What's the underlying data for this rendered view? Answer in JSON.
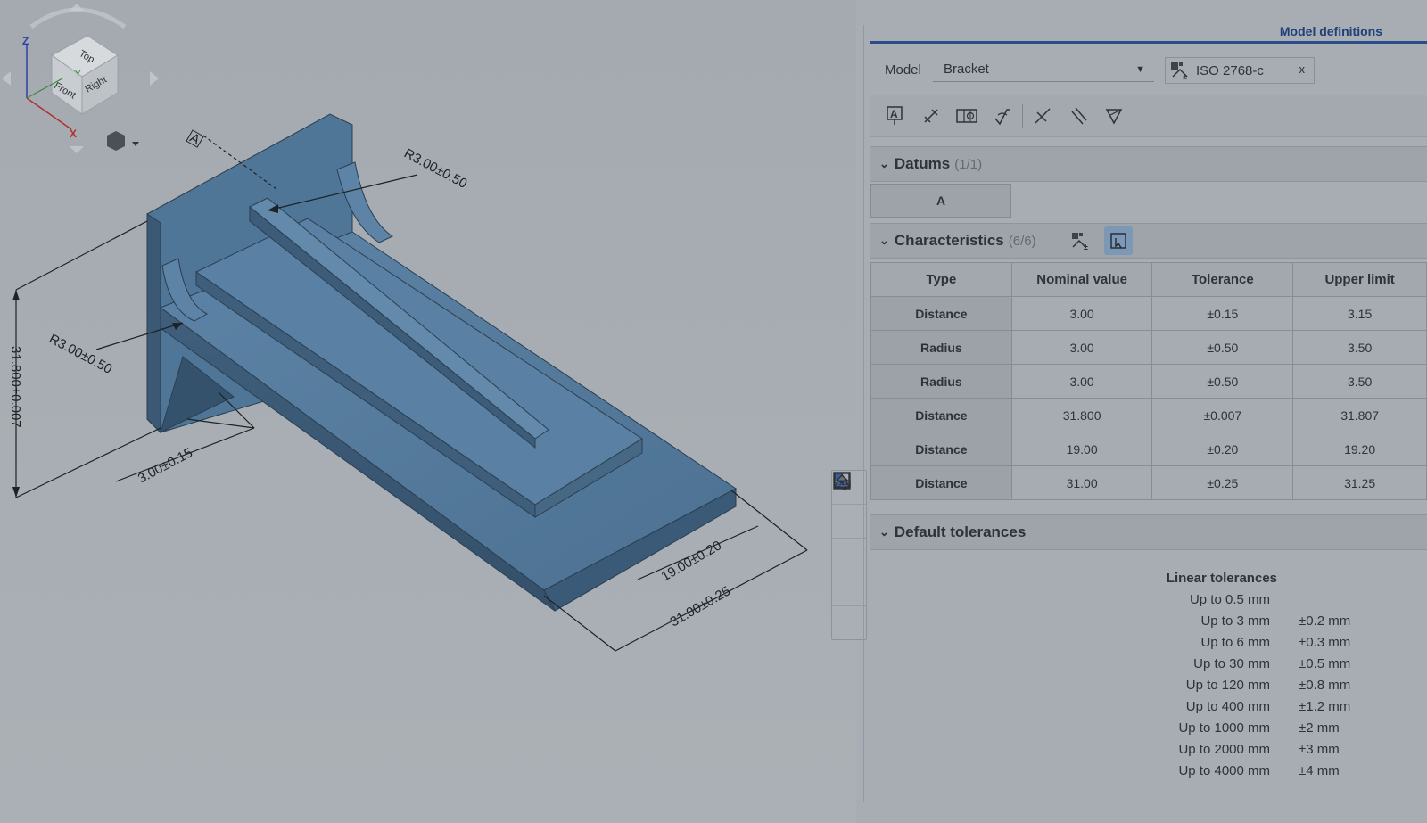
{
  "viewport": {
    "dimensions": [
      {
        "id": "r-top",
        "text": "R3.00±0.50"
      },
      {
        "id": "r-left",
        "text": "R3.00±0.50"
      },
      {
        "id": "vertical",
        "text": "31.800±0.007"
      },
      {
        "id": "depth",
        "text": "3.00±0.15"
      },
      {
        "id": "nineteen",
        "text": "19.00±0.20"
      },
      {
        "id": "thirtyone",
        "text": "31.00±0.25"
      }
    ],
    "datum_flag": "A",
    "viewcube": {
      "top": "Top",
      "front": "Front",
      "right": "Right",
      "axis_z": "Z",
      "axis_x": "X",
      "axis_y": "Y"
    },
    "side_tools": [
      "section-view-icon",
      "explode-view-icon",
      "named-views-icon",
      "render-mode-icon",
      "variables-icon"
    ]
  },
  "panel": {
    "title": "Model definitions",
    "model_label": "Model",
    "model_value": "Bracket",
    "standard": "ISO 2768-c",
    "standard_remove": "x",
    "toolbar_icons": [
      "annotation-icon",
      "dimension-icon",
      "feature-control-frame-icon",
      "surface-finish-icon",
      "angle-icon",
      "parallel-icon",
      "flatness-icon"
    ],
    "datums": {
      "title": "Datums",
      "count": "(1/1)",
      "items": [
        "A"
      ]
    },
    "characteristics": {
      "title": "Characteristics",
      "count": "(6/6)",
      "columns": [
        "Type",
        "Nominal value",
        "Tolerance",
        "Upper limit"
      ],
      "rows": [
        [
          "Distance",
          "3.00",
          "±0.15",
          "3.15"
        ],
        [
          "Radius",
          "3.00",
          "±0.50",
          "3.50"
        ],
        [
          "Radius",
          "3.00",
          "±0.50",
          "3.50"
        ],
        [
          "Distance",
          "31.800",
          "±0.007",
          "31.807"
        ],
        [
          "Distance",
          "19.00",
          "±0.20",
          "19.20"
        ],
        [
          "Distance",
          "31.00",
          "±0.25",
          "31.25"
        ]
      ]
    },
    "default_tolerances": {
      "title": "Default tolerances",
      "linear_title": "Linear tolerances",
      "rows": [
        {
          "limit": "Up to 0.5 mm",
          "value": ""
        },
        {
          "limit": "Up to 3 mm",
          "value": "±0.2 mm"
        },
        {
          "limit": "Up to 6 mm",
          "value": "±0.3 mm"
        },
        {
          "limit": "Up to 30 mm",
          "value": "±0.5 mm"
        },
        {
          "limit": "Up to 120 mm",
          "value": "±0.8 mm"
        },
        {
          "limit": "Up to 400 mm",
          "value": "±1.2 mm"
        },
        {
          "limit": "Up to 1000 mm",
          "value": "±2 mm"
        },
        {
          "limit": "Up to 2000 mm",
          "value": "±3 mm"
        },
        {
          "limit": "Up to 4000 mm",
          "value": "±4 mm"
        }
      ]
    }
  }
}
